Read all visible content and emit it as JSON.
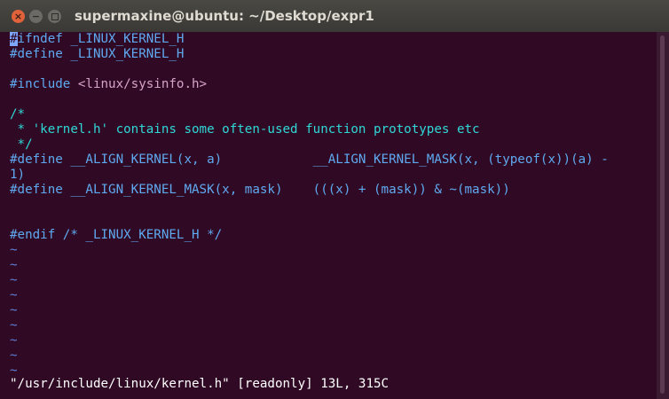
{
  "window": {
    "title": "supermaxine@ubuntu: ~/Desktop/expr1",
    "close_glyph": "×",
    "minimize_glyph": "−"
  },
  "editor": {
    "cursor_char": "#",
    "line1_rest": "ifndef _LINUX_KERNEL_H",
    "line2": "#define _LINUX_KERNEL_H",
    "line3": "",
    "line4_directive": "#include ",
    "line4_header": "<linux/sysinfo.h>",
    "line5": "",
    "line6": "/*",
    "line7": " * 'kernel.h' contains some often-used function prototypes etc",
    "line8": " */",
    "line9": "#define __ALIGN_KERNEL(x, a)            __ALIGN_KERNEL_MASK(x, (typeof(x))(a) -",
    "line10": "1)",
    "line11": "#define __ALIGN_KERNEL_MASK(x, mask)    (((x) + (mask)) & ~(mask))",
    "line12": "",
    "line13": "",
    "line14": "#endif /* _LINUX_KERNEL_H */",
    "tilde": "~",
    "status_line": "\"/usr/include/linux/kernel.h\" [readonly] 13L, 315C"
  },
  "colors": {
    "terminal_bg": "#300a24",
    "text": "#2fd7d7",
    "preprocessor": "#5fa9f0",
    "include_string": "#d6a3c8",
    "tilde": "#5f7fd6",
    "close_button": "#e0623a"
  }
}
